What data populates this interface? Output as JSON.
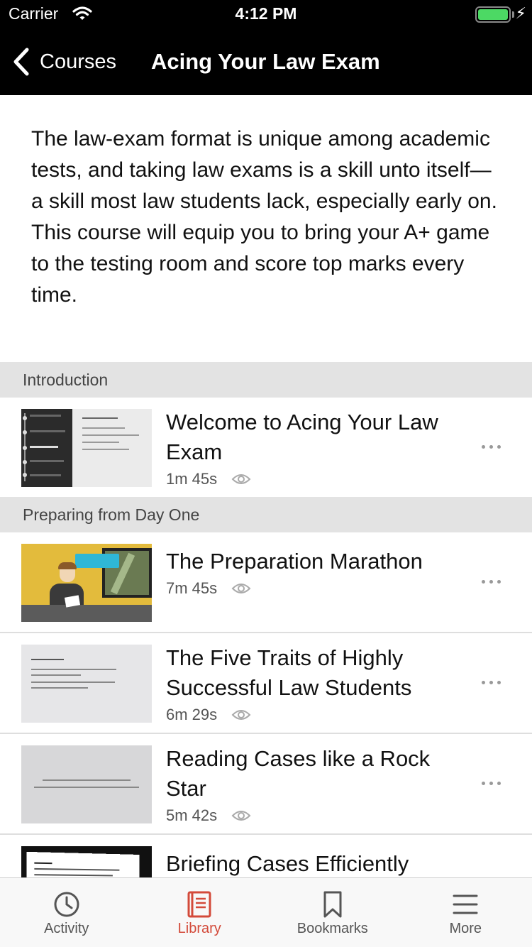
{
  "status_bar": {
    "carrier": "Carrier",
    "time": "4:12 PM",
    "battery_level": 1.0
  },
  "nav": {
    "back_label": "Courses",
    "title": "Acing Your Law Exam"
  },
  "course": {
    "description": "The law-exam format is unique among academic tests, and taking law exams is a skill unto itself—a skill most law students lack, especially early on. This course will equip you to bring your A+ game to the testing room and score top marks every time."
  },
  "sections": [
    {
      "header": "Introduction",
      "lessons": [
        {
          "title": "Welcome to Acing Your Law Exam",
          "duration": "1m 45s",
          "thumbnail": "chapter-slide"
        }
      ]
    },
    {
      "header": "Preparing from Day One",
      "lessons": [
        {
          "title": "The Preparation Marathon",
          "duration": "7m 45s",
          "thumbnail": "animated-student"
        },
        {
          "title": "The Five Traits of Highly Successful Law Students",
          "duration": "6m 29s",
          "thumbnail": "diligence-slide"
        },
        {
          "title": "Reading Cases like a Rock Star",
          "duration": "5m 42s",
          "thumbnail": "think-like-lawyer-slide"
        },
        {
          "title": "Briefing Cases Efficiently",
          "duration": "",
          "thumbnail": "document-page"
        }
      ]
    }
  ],
  "tabbar": {
    "items": [
      {
        "label": "Activity",
        "icon": "clock-icon",
        "active": false
      },
      {
        "label": "Library",
        "icon": "book-icon",
        "active": true
      },
      {
        "label": "Bookmarks",
        "icon": "bookmark-icon",
        "active": false
      },
      {
        "label": "More",
        "icon": "menu-icon",
        "active": false
      }
    ]
  },
  "colors": {
    "accent": "#d34a3a",
    "nav_background": "#000000",
    "section_background": "#e3e3e3",
    "battery": "#4cd964"
  }
}
